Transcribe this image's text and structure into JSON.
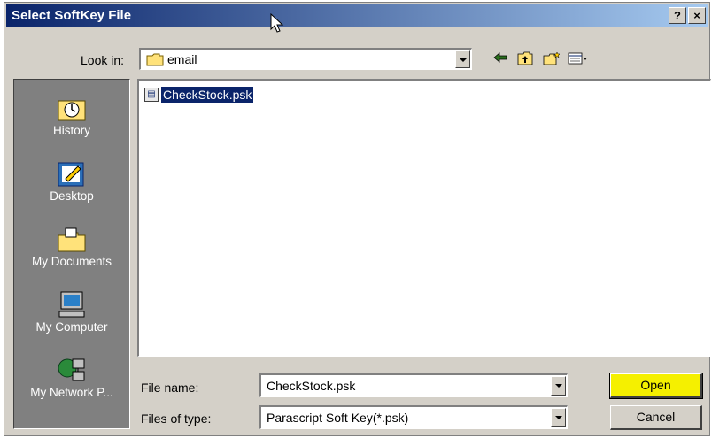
{
  "window": {
    "title": "Select SoftKey File",
    "help_button": "?",
    "close_button": "×"
  },
  "lookin": {
    "label": "Look in:",
    "value": "email"
  },
  "toolbar": {
    "back_icon": "back-arrow-icon",
    "up_icon": "up-folder-icon",
    "new_folder_icon": "new-folder-icon",
    "view_menu_icon": "view-menu-icon"
  },
  "places": [
    {
      "label": "History",
      "icon": "history-icon"
    },
    {
      "label": "Desktop",
      "icon": "desktop-icon"
    },
    {
      "label": "My Documents",
      "icon": "my-documents-icon"
    },
    {
      "label": "My Computer",
      "icon": "my-computer-icon"
    },
    {
      "label": "My Network P...",
      "icon": "my-network-places-icon"
    }
  ],
  "files": [
    {
      "name": "CheckStock.psk",
      "selected": true
    }
  ],
  "filename": {
    "label": "File name:",
    "value": "CheckStock.psk"
  },
  "filetype": {
    "label": "Files of type:",
    "value": "Parascript Soft Key(*.psk)"
  },
  "buttons": {
    "open": "Open",
    "cancel": "Cancel"
  },
  "colors": {
    "title_start": "#0a246a",
    "title_end": "#a6caf0",
    "dialog_bg": "#d4d0c8",
    "selection": "#0a246a",
    "open_highlight": "#f5f000"
  }
}
